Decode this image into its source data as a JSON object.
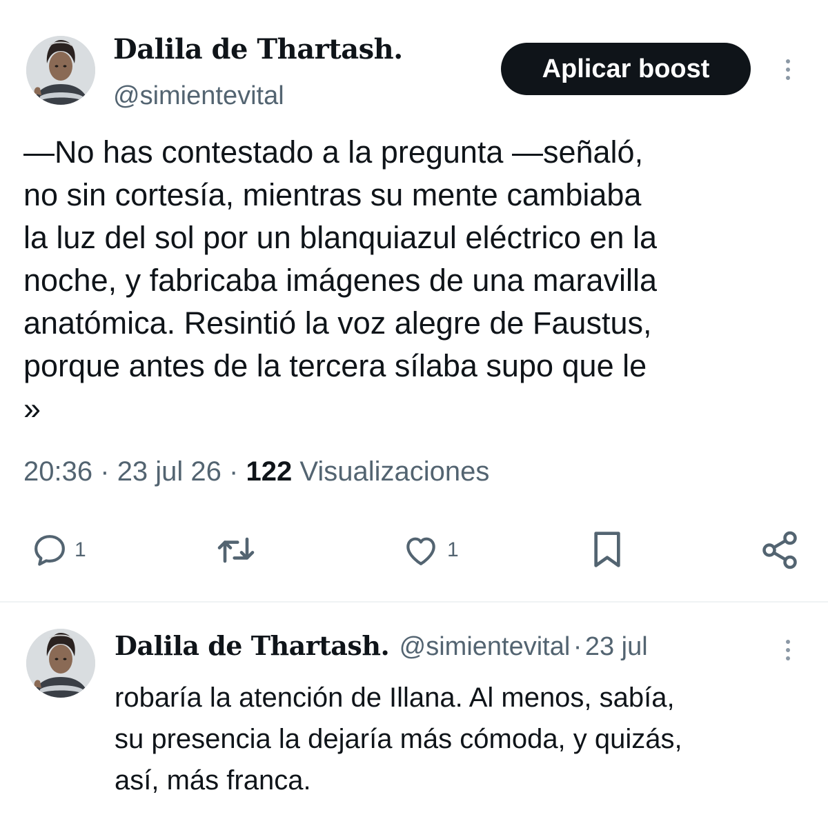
{
  "tweet": {
    "author_name": "Dalila de Thartash.",
    "author_handle": "@simientevital",
    "boost_label": "Aplicar boost",
    "text": "—No has contestado a la pregunta —señaló,\nno sin cortesía, mientras su mente cambiaba\nla luz del sol por un blanquiazul eléctrico en la\nnoche, y fabricaba imágenes de una maravilla\nanatómica. Resintió la voz alegre de Faustus,\nporque antes de la tercera sílaba supo que le\n»",
    "time": "20:36",
    "date": "23 jul 26",
    "separator": "·",
    "views_count": "122",
    "views_label": "Visualizaciones",
    "actions": {
      "reply_count": "1",
      "retweet_count": "",
      "like_count": "1"
    },
    "icons": [
      "reply-icon",
      "retweet-icon",
      "like-icon",
      "bookmark-icon",
      "share-icon",
      "more-options-icon"
    ]
  },
  "reply": {
    "author_name": "Dalila de Thartash.",
    "author_handle": "@simientevital",
    "separator": "·",
    "date": "23 jul",
    "text": "robaría la atención de Illana. Al menos, sabía,\nsu presencia la dejaría más cómoda, y quizás,\nasí, más franca."
  },
  "colors": {
    "text": "#0f1419",
    "secondary": "#536471",
    "button_bg": "#0f1419",
    "divider": "#eff3f4"
  }
}
